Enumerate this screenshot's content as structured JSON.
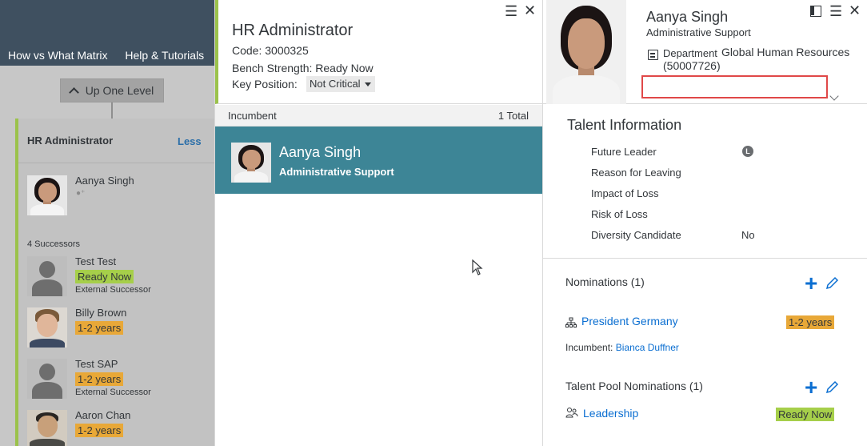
{
  "background_page": {
    "nav_items": [
      "How vs What Matrix",
      "Help & Tutorials"
    ],
    "up_one_level": "Up One Level",
    "node": {
      "title": "HR Administrator",
      "toggle": "Less",
      "incumbent": "Aanya Singh",
      "successors_count": "4 Successors",
      "successors": [
        {
          "name": "Test Test",
          "readiness": "Ready Now",
          "note": "External Successor"
        },
        {
          "name": "Billy Brown",
          "readiness": "1-2 years",
          "note": ""
        },
        {
          "name": "Test SAP",
          "readiness": "1-2 years",
          "note": "External Successor"
        },
        {
          "name": "Aaron Chan",
          "readiness": "1-2 years",
          "note": ""
        }
      ]
    }
  },
  "position_panel": {
    "title": "HR Administrator",
    "code_line": "Code: 3000325",
    "bench_line": "Bench Strength: Ready Now",
    "key_position_label": "Key Position:",
    "key_position_value": "Not Critical",
    "incumbent_label": "Incumbent",
    "incumbent_total": "1 Total",
    "incumbent_card": {
      "name": "Aanya Singh",
      "role": "Administrative Support"
    }
  },
  "profile_panel": {
    "name": "Aanya Singh",
    "role": "Administrative Support",
    "department_label": "Department",
    "department_value": "Global Human Resources",
    "department_code": "(50007726)",
    "talent_title": "Talent Information",
    "talent_rows": [
      {
        "label": "Future Leader",
        "value": ""
      },
      {
        "label": "Reason for Leaving",
        "value": ""
      },
      {
        "label": "Impact of Loss",
        "value": ""
      },
      {
        "label": "Risk of Loss",
        "value": ""
      },
      {
        "label": "Diversity Candidate",
        "value": "No"
      }
    ],
    "future_leader_badge": "L",
    "nominations": {
      "title": "Nominations (1)",
      "position": "President Germany",
      "readiness": "1-2 years",
      "incumbent_label": "Incumbent:",
      "incumbent_name": "Bianca Duffner"
    },
    "talent_pool": {
      "title": "Talent Pool Nominations (1)",
      "pool": "Leadership",
      "readiness": "Ready Now"
    }
  },
  "colors": {
    "accent_green": "#9bc24b",
    "teal_selection": "#3d8596",
    "link_blue": "#0a6ed1",
    "ready_now": "#a6cf4a",
    "one_two_years": "#e8a838",
    "highlight_box": "#e04848"
  },
  "icons": [
    "hamburger-menu-icon",
    "close-icon",
    "panel-toggle-icon",
    "department-icon",
    "add-icon",
    "edit-pencil-icon",
    "org-chart-icon",
    "talent-pool-icon",
    "chevron-up-icon",
    "chevron-down-icon",
    "future-leader-badge-icon"
  ]
}
